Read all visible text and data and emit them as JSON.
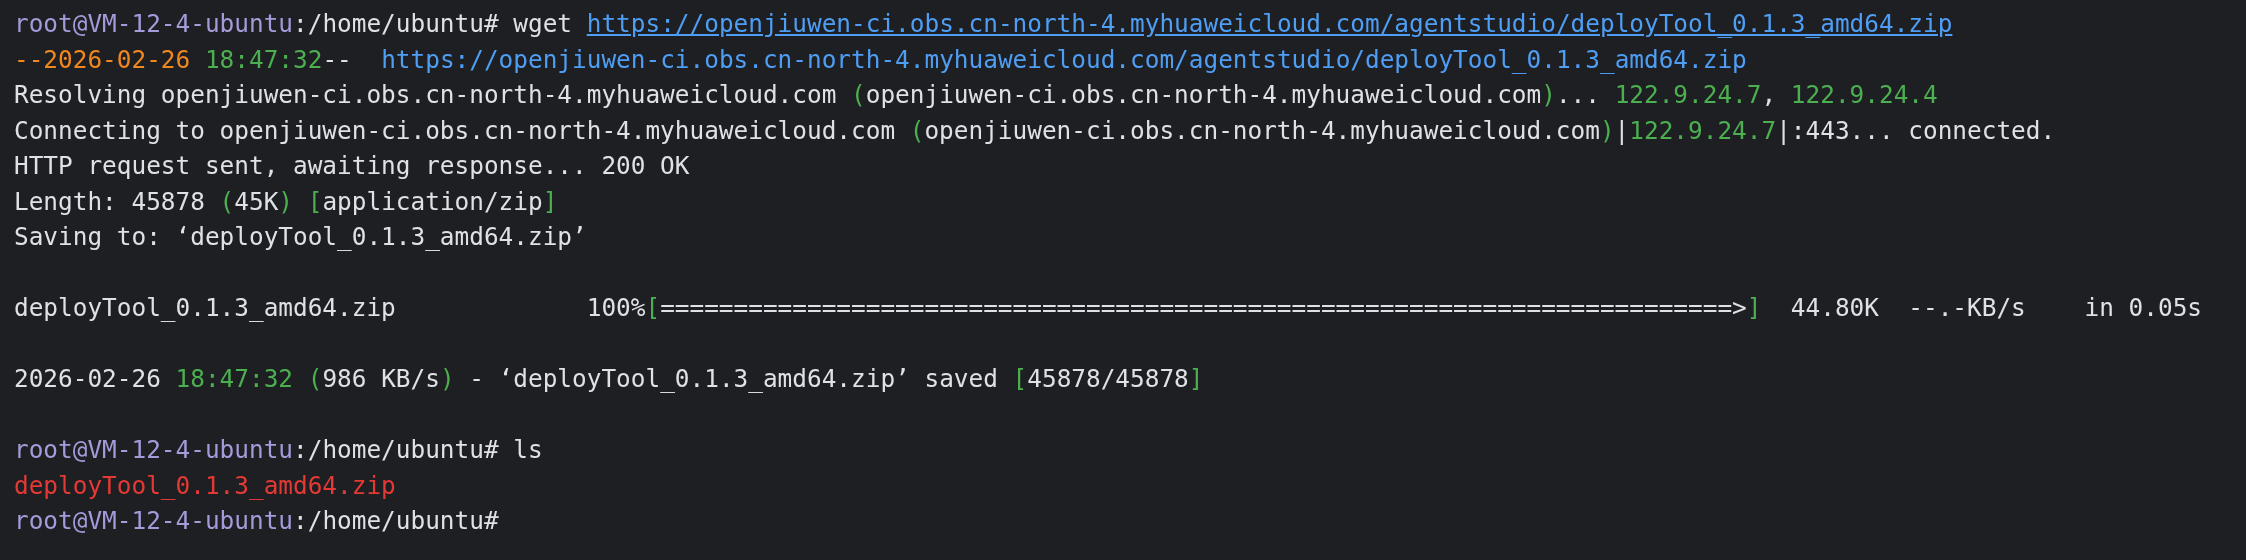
{
  "lines": [
    {
      "segments": [
        {
          "kind": "prompt",
          "text": "root@VM-12-4-ubuntu"
        },
        {
          "kind": "text",
          "text": ":/home/ubuntu# wget "
        },
        {
          "kind": "url",
          "text": "https://openjiuwen-ci.obs.cn-north-4.myhuaweicloud.com/agentstudio/deployTool_0.1.3_amd64.zip"
        }
      ]
    },
    {
      "segments": [
        {
          "kind": "date",
          "text": "--2026-02-26 "
        },
        {
          "kind": "accent",
          "text": "18:47:32"
        },
        {
          "kind": "text",
          "text": "--  "
        },
        {
          "kind": "link",
          "text": "https://openjiuwen-ci.obs.cn-north-4.myhuaweicloud.com/agentstudio/deployTool_0.1.3_amd64.zip"
        }
      ]
    },
    {
      "segments": [
        {
          "kind": "text",
          "text": "Resolving openjiuwen-ci.obs.cn-north-4.myhuaweicloud.com "
        },
        {
          "kind": "accent",
          "text": "("
        },
        {
          "kind": "text",
          "text": "openjiuwen-ci.obs.cn-north-4.myhuaweicloud.com"
        },
        {
          "kind": "accent",
          "text": ")"
        },
        {
          "kind": "text",
          "text": "... "
        },
        {
          "kind": "accent",
          "text": "122.9.24.7"
        },
        {
          "kind": "text",
          "text": ", "
        },
        {
          "kind": "accent",
          "text": "122.9.24.4"
        }
      ]
    },
    {
      "segments": [
        {
          "kind": "text",
          "text": "Connecting to openjiuwen-ci.obs.cn-north-4.myhuaweicloud.com "
        },
        {
          "kind": "accent",
          "text": "("
        },
        {
          "kind": "text",
          "text": "openjiuwen-ci.obs.cn-north-4.myhuaweicloud.com"
        },
        {
          "kind": "accent",
          "text": ")"
        },
        {
          "kind": "text",
          "text": "|"
        },
        {
          "kind": "accent",
          "text": "122.9.24.7"
        },
        {
          "kind": "text",
          "text": "|:443... connected."
        }
      ]
    },
    {
      "segments": [
        {
          "kind": "text",
          "text": "HTTP request sent, awaiting response... 200 OK"
        }
      ]
    },
    {
      "segments": [
        {
          "kind": "text",
          "text": "Length: 45878 "
        },
        {
          "kind": "accent",
          "text": "("
        },
        {
          "kind": "text",
          "text": "45K"
        },
        {
          "kind": "accent",
          "text": ") ["
        },
        {
          "kind": "text",
          "text": "application/zip"
        },
        {
          "kind": "accent",
          "text": "]"
        }
      ]
    },
    {
      "segments": [
        {
          "kind": "text",
          "text": "Saving to: ‘deployTool_0.1.3_amd64.zip’"
        }
      ]
    },
    {
      "kind": "blank"
    },
    {
      "segments": [
        {
          "kind": "text",
          "text": "deployTool_0.1.3_amd64.zip             100%"
        },
        {
          "kind": "accent",
          "text": "["
        },
        {
          "kind": "text",
          "text": "=========================================================================>"
        },
        {
          "kind": "accent",
          "text": "]"
        },
        {
          "kind": "text",
          "text": "  44.80K  --.-KB/s    in 0.05s"
        }
      ]
    },
    {
      "kind": "blank"
    },
    {
      "segments": [
        {
          "kind": "text",
          "text": "2026-02-26 "
        },
        {
          "kind": "accent",
          "text": "18:47:32 ("
        },
        {
          "kind": "text",
          "text": "986 KB/s"
        },
        {
          "kind": "accent",
          "text": ")"
        },
        {
          "kind": "text",
          "text": " - ‘deployTool_0.1.3_amd64.zip’ saved "
        },
        {
          "kind": "accent",
          "text": "["
        },
        {
          "kind": "text",
          "text": "45878/45878"
        },
        {
          "kind": "accent",
          "text": "]"
        }
      ]
    },
    {
      "kind": "blank"
    },
    {
      "segments": [
        {
          "kind": "prompt",
          "text": "root@VM-12-4-ubuntu"
        },
        {
          "kind": "text",
          "text": ":/home/ubuntu# ls"
        }
      ]
    },
    {
      "segments": [
        {
          "kind": "file",
          "text": "deployTool_0.1.3_amd64.zip"
        }
      ]
    },
    {
      "segments": [
        {
          "kind": "prompt",
          "text": "root@VM-12-4-ubuntu"
        },
        {
          "kind": "text",
          "text": ":/home/ubuntu#"
        }
      ]
    }
  ]
}
